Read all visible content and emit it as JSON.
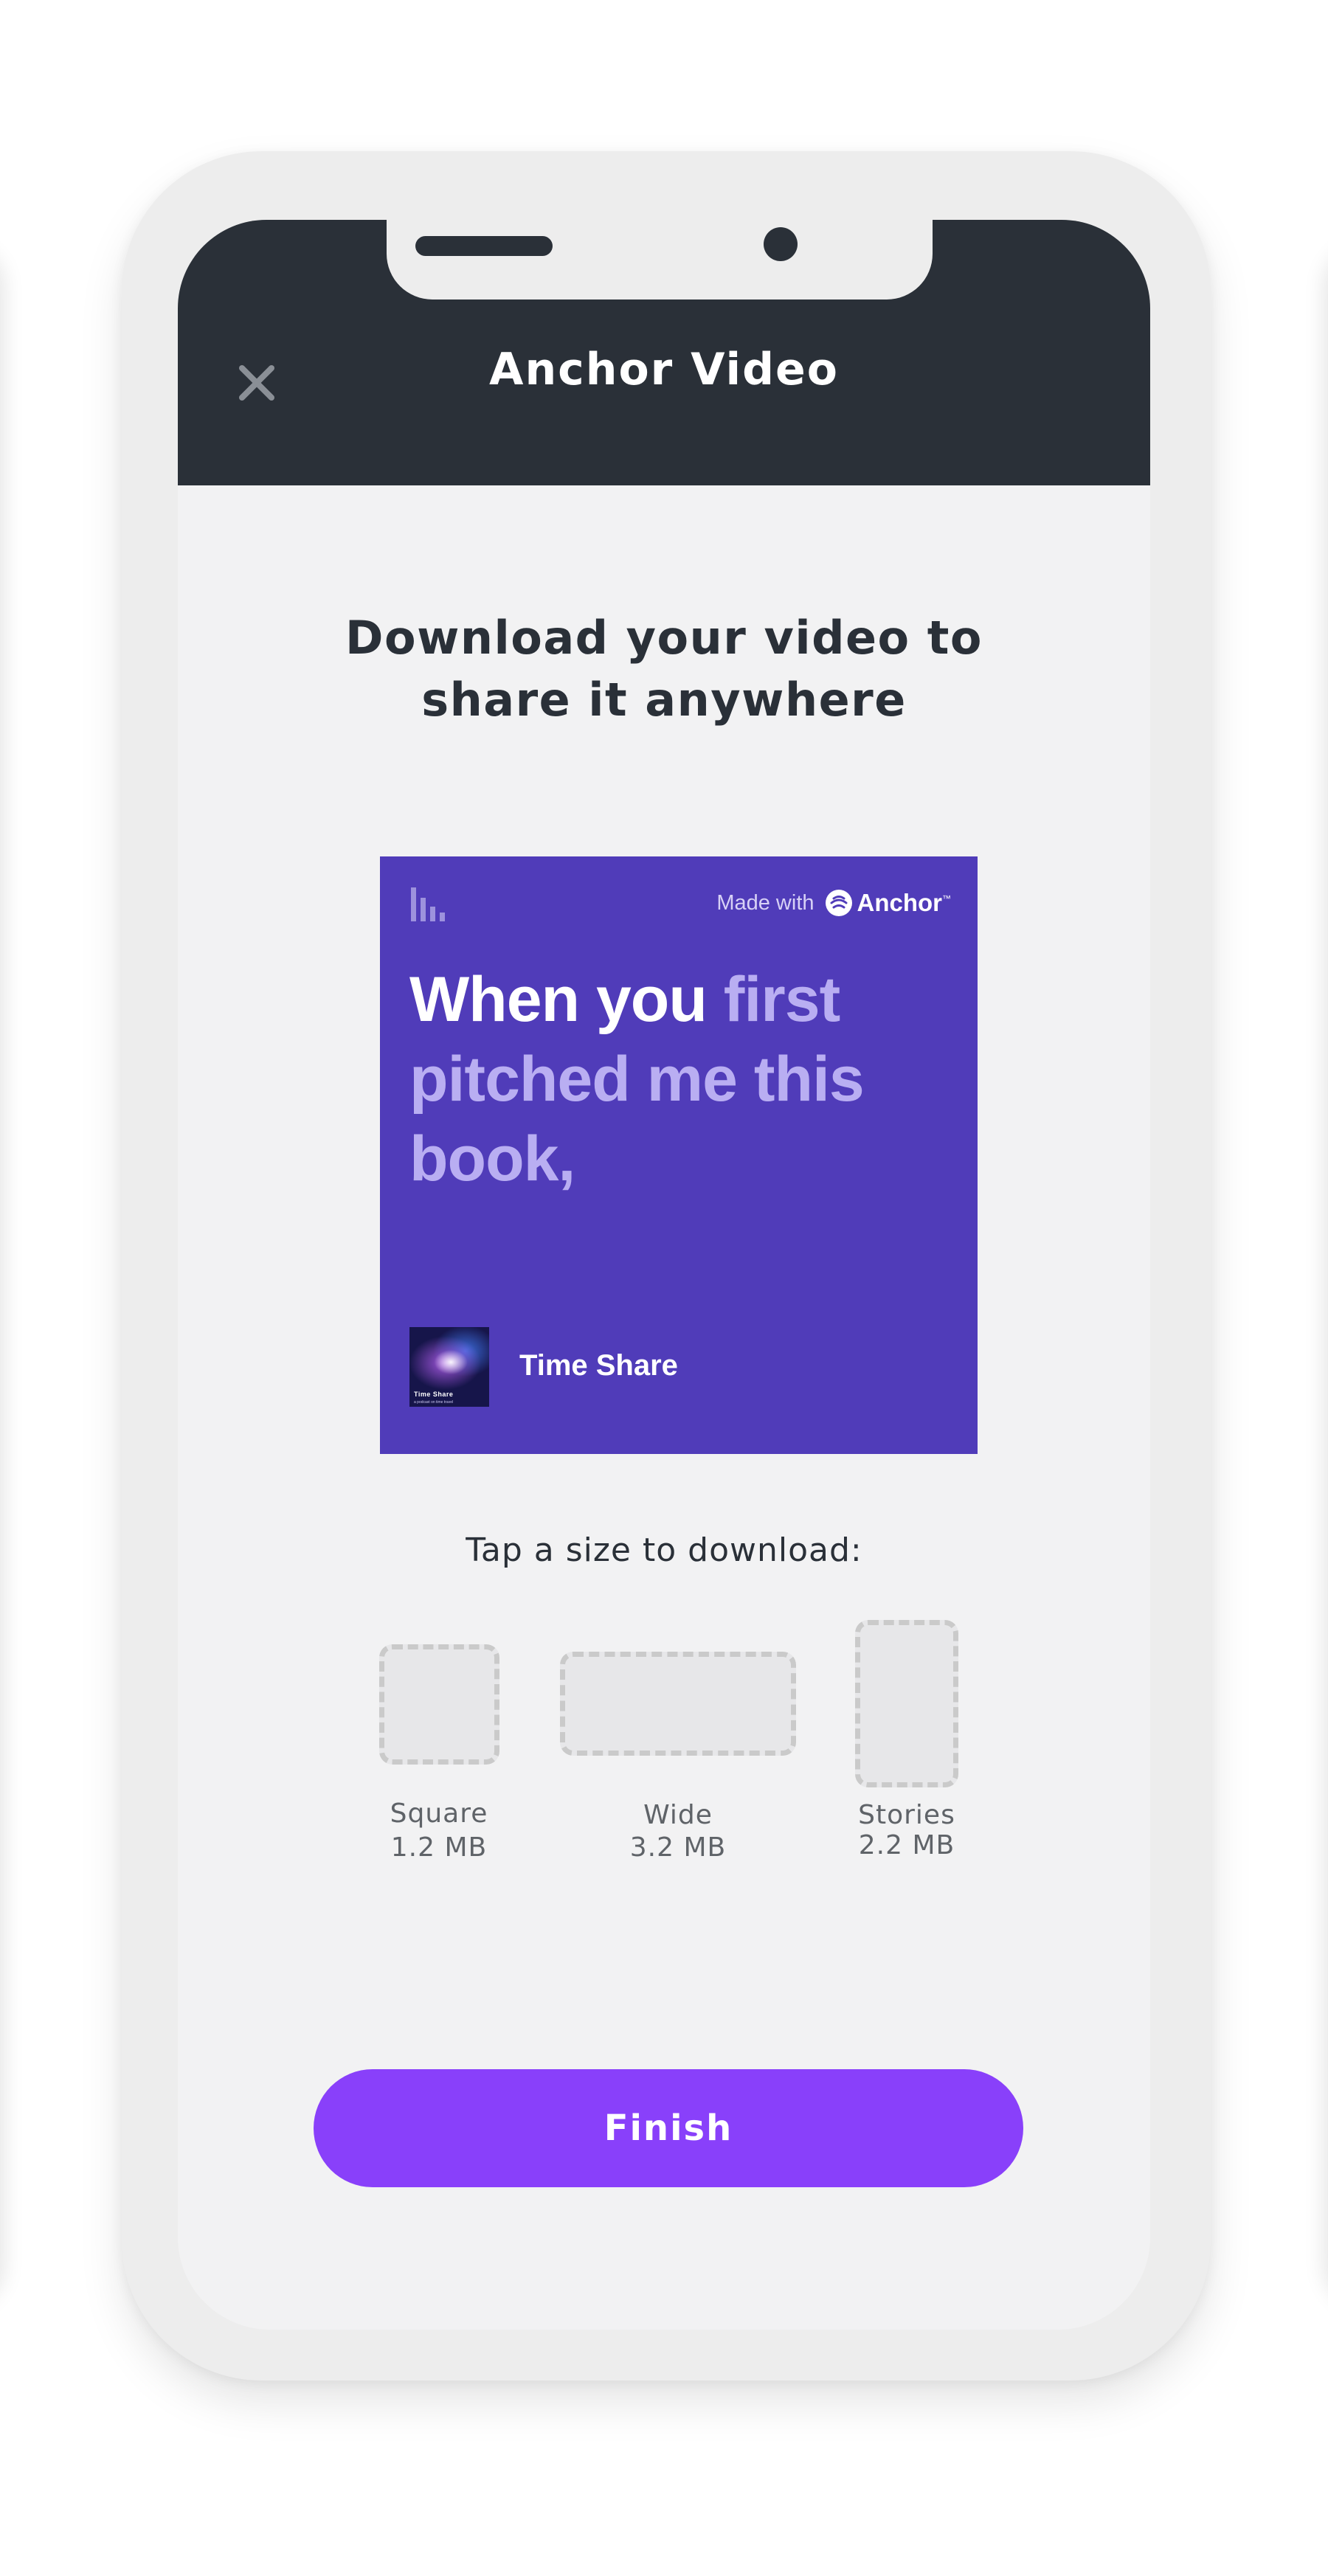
{
  "app": {
    "title": "Anchor Video"
  },
  "header": {
    "title": "Anchor Video",
    "close_icon": "close-icon"
  },
  "main": {
    "headline_line1": "Download your video to",
    "headline_line2": "share it anywhere"
  },
  "preview": {
    "background_color": "#503cb9",
    "icon": "bars-icon",
    "made_with_label": "Made with",
    "brand_name": "Anchor",
    "brand_mark": "™",
    "quote_highlight": "When you",
    "quote_rest_line1": "first",
    "quote_rest_line2": "pitched me this",
    "quote_rest_line3": "book,",
    "podcast_name": "Time Share",
    "cover_title": "Time Share",
    "cover_subtitle": "a podcast on time travel"
  },
  "download": {
    "prompt": "Tap a size to download:",
    "options": [
      {
        "name": "Square",
        "size": "1.2 MB"
      },
      {
        "name": "Wide",
        "size": "3.2 MB"
      },
      {
        "name": "Stories",
        "size": "2.2 MB"
      }
    ]
  },
  "footer": {
    "finish_label": "Finish"
  },
  "colors": {
    "header_bg": "#2a3038",
    "screen_bg": "#f2f2f3",
    "accent": "#8940fa",
    "preview_bg": "#503cb9",
    "quote_dim": "#b9aef2"
  }
}
